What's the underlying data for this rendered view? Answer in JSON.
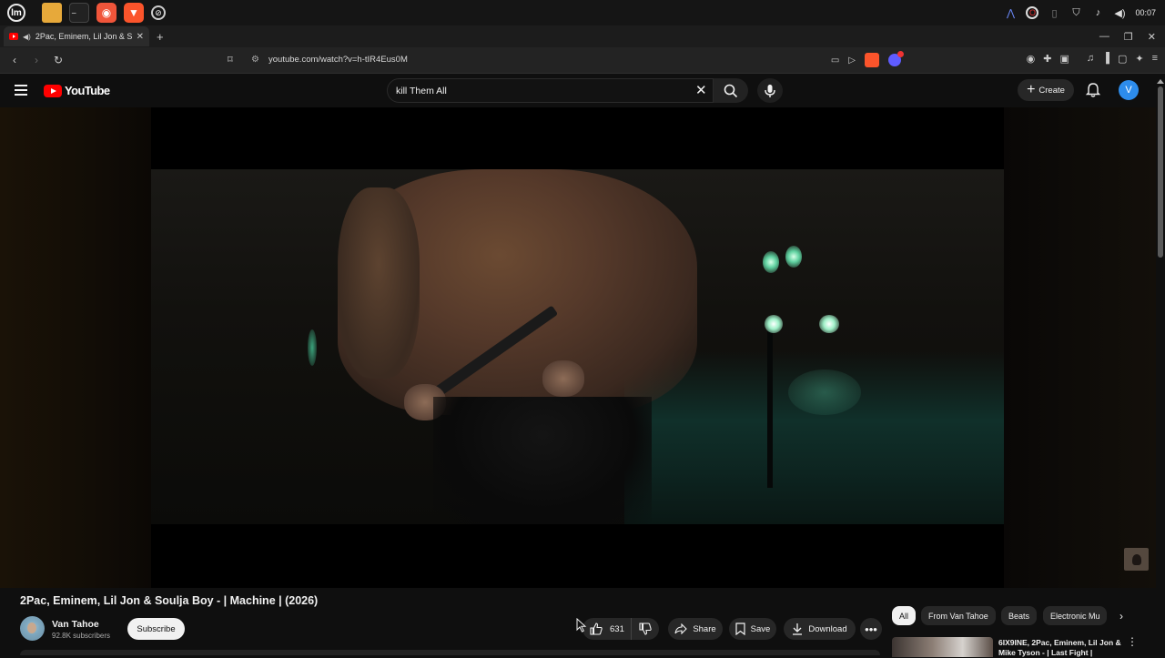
{
  "os": {
    "clock": "00:07",
    "apps": [
      "mint-menu-icon",
      "files-icon",
      "terminal-icon",
      "firefox-icon",
      "brave-icon",
      "vpn-icon"
    ]
  },
  "browser": {
    "tab_title": "2Pac, Eminem, Lil Jon & So",
    "tab_close": "✕",
    "new_tab": "+",
    "url": "youtube.com/watch?v=h-tIR4Eus0M"
  },
  "youtube": {
    "logo_text": "YouTube",
    "search_query": "kill Them All",
    "create_label": "Create",
    "avatar_letter": "V"
  },
  "video": {
    "title": "2Pac, Eminem, Lil Jon & Soulja Boy - | Machine | (2026)",
    "channel_name": "Van Tahoe",
    "subscribers": "92.8K subscribers",
    "subscribe_label": "Subscribe",
    "likes": "631",
    "share_label": "Share",
    "save_label": "Save",
    "download_label": "Download",
    "more_label": "•••"
  },
  "sidebar": {
    "chips": [
      {
        "label": "All",
        "active": true
      },
      {
        "label": "From Van Tahoe",
        "active": false
      },
      {
        "label": "Beats",
        "active": false
      },
      {
        "label": "Electronic Mu",
        "active": false
      }
    ],
    "recommendation": {
      "title": "6IX9INE, 2Pac, Eminem, Lil Jon & Mike Tyson - | Last Fight |"
    }
  },
  "colors": {
    "background": "#0f0f0f",
    "youtube_red": "#ff0000",
    "pill": "#272727",
    "avatar_blue": "#2d8ceb"
  }
}
